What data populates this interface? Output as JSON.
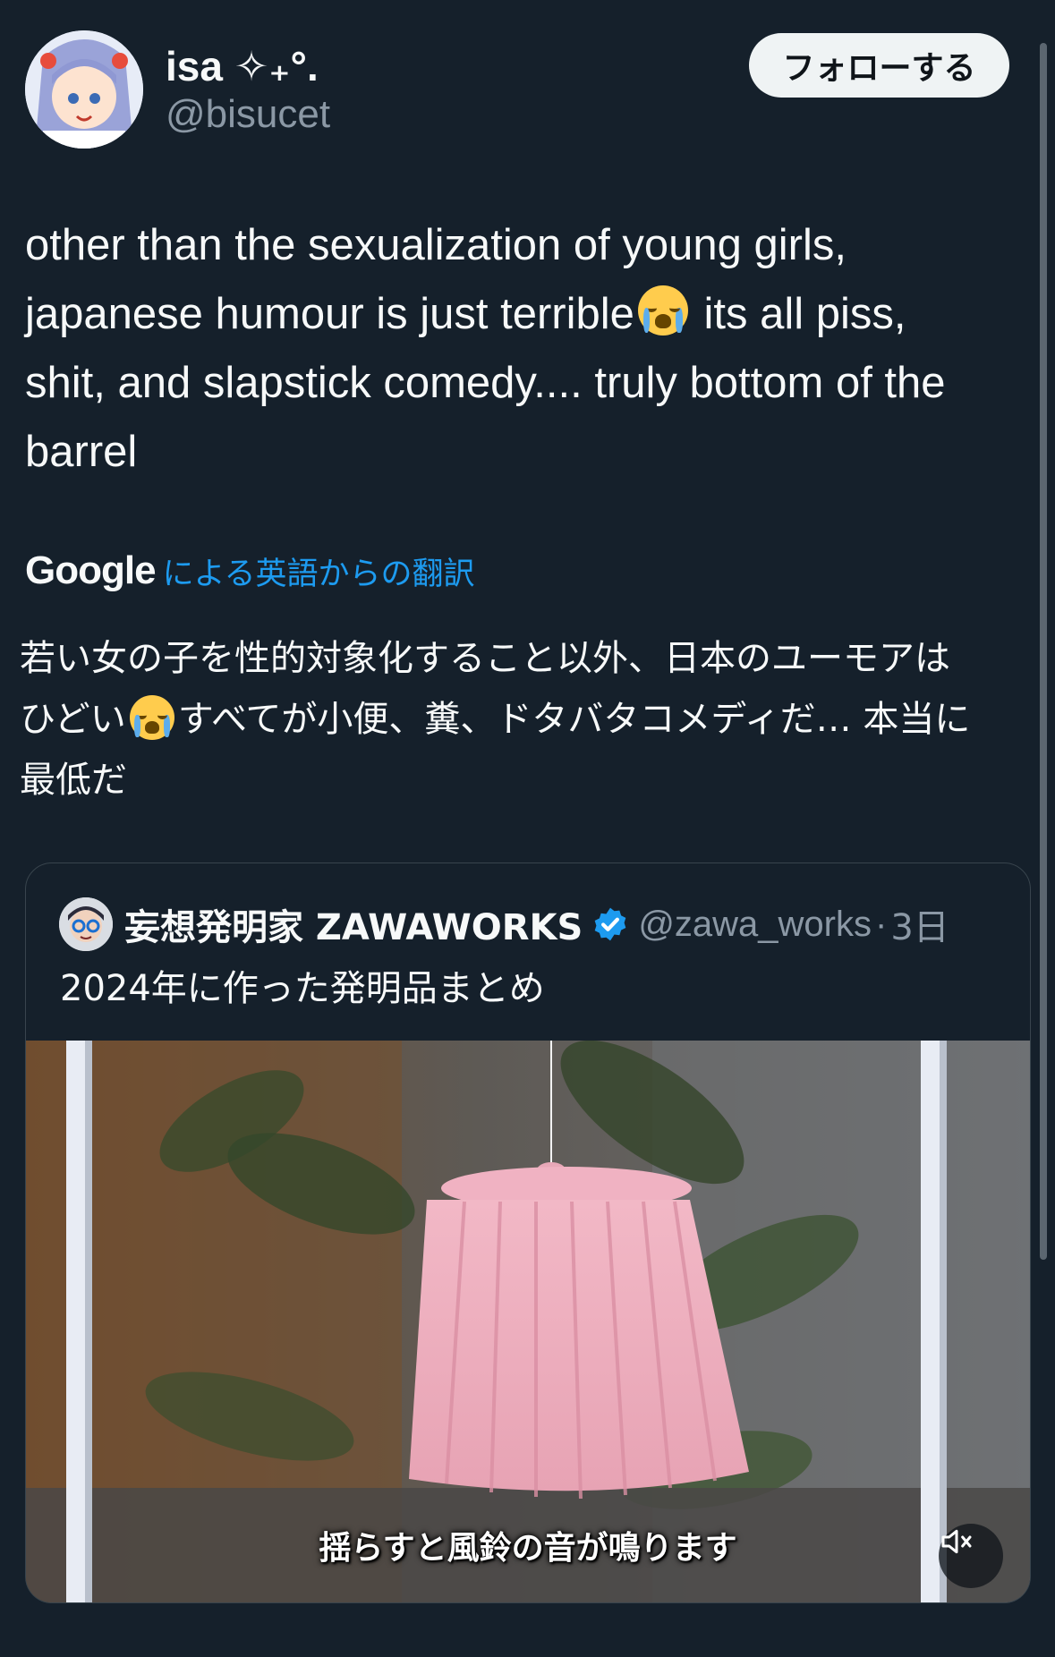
{
  "post": {
    "author": {
      "display_name": "isa ✧₊°.",
      "handle": "@bisucet",
      "avatar": "anime-girl-avatar"
    },
    "follow_label": "フォローする",
    "text_line1": "other than the sexualization of young girls,",
    "text_line2a": "japanese humour is just terrible",
    "text_line2b": " its all piss,",
    "text_line3": "shit, and slapstick comedy.... truly bottom of the",
    "text_line4": "barrel",
    "emoji": "loudly-crying-face"
  },
  "translation": {
    "provider": "Google",
    "label": "による英語からの翻訳",
    "line1": "若い女の子を性的対象化すること以外、日本のユーモアは",
    "line2a": "ひどい",
    "line2b": "すべてが小便、糞、ドタバタコメディだ… 本当に",
    "line3": "最低だ"
  },
  "quote": {
    "author_name": "妄想発明家 ZAWAWORKS",
    "verified": true,
    "handle": "@zawa_works",
    "separator": "·",
    "time": "3日",
    "text": "2024年に作った発明品まとめ",
    "media": {
      "subtitle": "揺らすと風鈴の音が鳴ります",
      "mute_icon": "speaker-muted-icon"
    }
  },
  "colors": {
    "background": "#15202b",
    "text": "#f7f9f9",
    "secondary": "#8b98a5",
    "link": "#1d9bf0",
    "border": "#38444d"
  }
}
